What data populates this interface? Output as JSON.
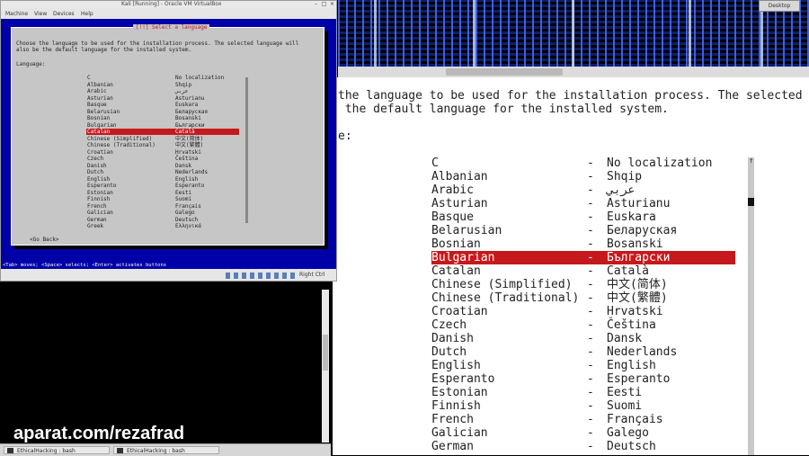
{
  "vbox": {
    "title": "Kali [Running] - Oracle VM VirtualBox",
    "menu": [
      "Machine",
      "View",
      "Devices",
      "Help"
    ],
    "status_right": "Right Ctrl"
  },
  "installer": {
    "dialog_title": "[!!] Select a language",
    "intro_line1": "Choose the language to be used for the installation process. The selected language will",
    "intro_line2": "also be the default language for the installed system.",
    "language_label": "Language:",
    "languages": [
      {
        "name": "C",
        "native": "No localization"
      },
      {
        "name": "Albanian",
        "native": "Shqip"
      },
      {
        "name": "Arabic",
        "native": "عربي"
      },
      {
        "name": "Asturian",
        "native": "Asturianu"
      },
      {
        "name": "Basque",
        "native": "Euskara"
      },
      {
        "name": "Belarusian",
        "native": "Беларуская"
      },
      {
        "name": "Bosnian",
        "native": "Bosanski"
      },
      {
        "name": "Bulgarian",
        "native": "Български"
      },
      {
        "name": "Catalan",
        "native": "Català"
      },
      {
        "name": "Chinese (Simplified)",
        "native": "中文(简体)"
      },
      {
        "name": "Chinese (Traditional)",
        "native": "中文(繁體)"
      },
      {
        "name": "Croatian",
        "native": "Hrvatski"
      },
      {
        "name": "Czech",
        "native": "Čeština"
      },
      {
        "name": "Danish",
        "native": "Dansk"
      },
      {
        "name": "Dutch",
        "native": "Nederlands"
      },
      {
        "name": "English",
        "native": "English"
      },
      {
        "name": "Esperanto",
        "native": "Esperanto"
      },
      {
        "name": "Estonian",
        "native": "Eesti"
      },
      {
        "name": "Finnish",
        "native": "Suomi"
      },
      {
        "name": "French",
        "native": "Français"
      },
      {
        "name": "Galician",
        "native": "Galego"
      },
      {
        "name": "German",
        "native": "Deutsch"
      },
      {
        "name": "Greek",
        "native": "Ελληνικά"
      }
    ],
    "small_selected": "Catalan",
    "zoom_selected": "Bulgarian",
    "go_back": "<Go Back>",
    "hint": "<Tab> moves; <Space> selects; <Enter> activates buttons"
  },
  "zoomed": {
    "line1": "the language to be used for the installation process. The selected lan",
    "line2": " the default language for the installed system.",
    "line3": "e:",
    "separator": "-",
    "scroll_up": "↑"
  },
  "desktop_button": "Desktop",
  "taskbar": {
    "tasks": [
      "EthicalHacking : bash",
      "EthicalHacking : bash"
    ]
  },
  "watermark": "aparat.com/rezafrad"
}
